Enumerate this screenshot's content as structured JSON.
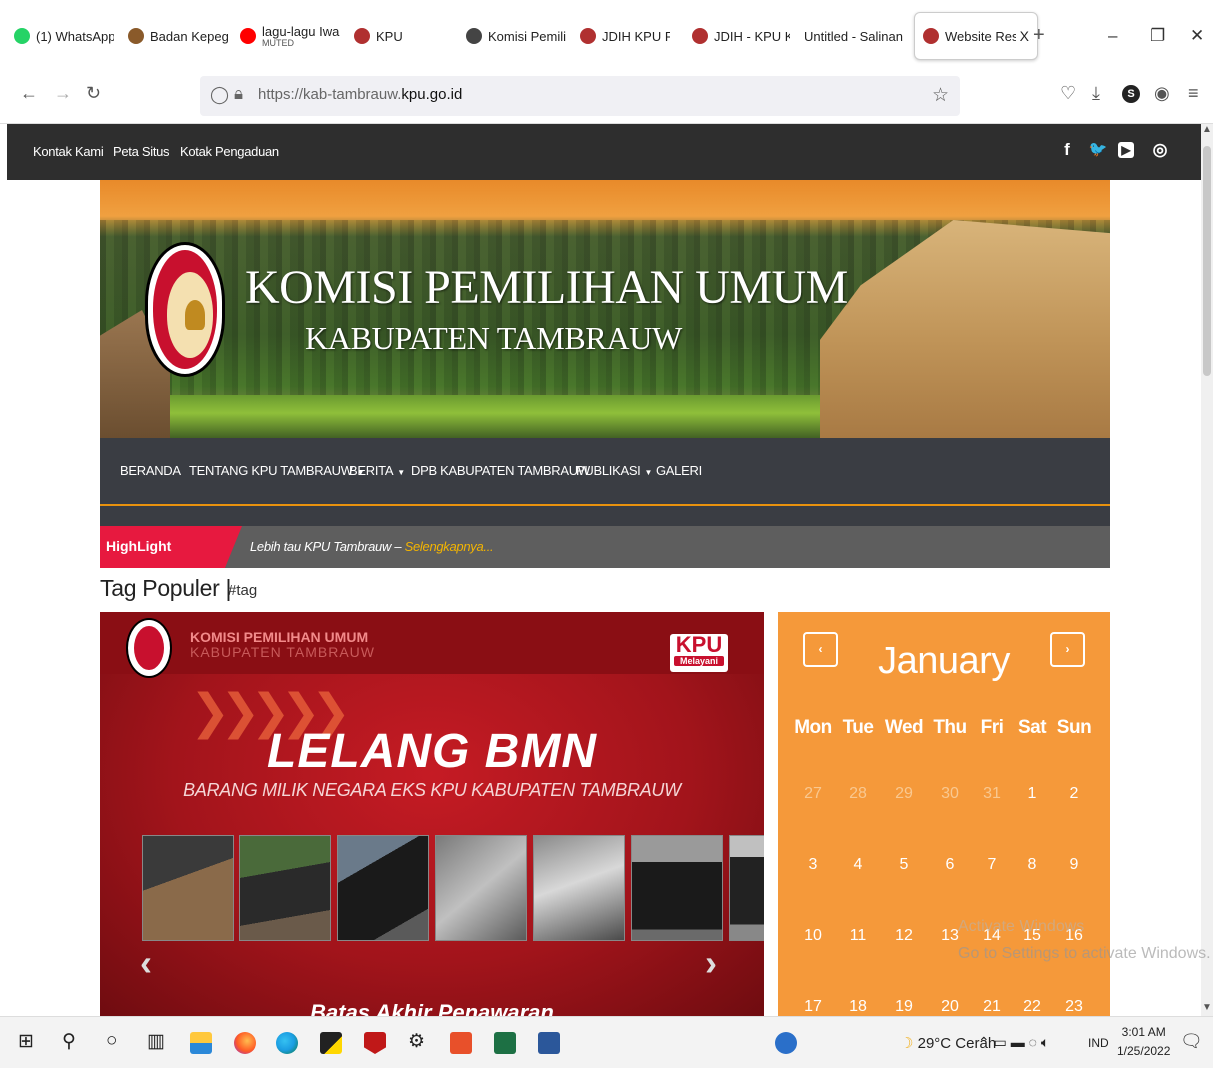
{
  "browser": {
    "tabs": [
      {
        "title": "(1) WhatsApp",
        "icon": "whatsapp-icon",
        "color": "#25d366"
      },
      {
        "title": "Badan Kepegaw",
        "icon": "kpu-logo-icon",
        "color": "#8a5a2a"
      },
      {
        "title": "lagu-lagu Iwan F",
        "subtitle": "MUTED",
        "icon": "youtube-icon",
        "color": "#ff0000"
      },
      {
        "title": "KPU",
        "icon": "kpu-logo-icon",
        "color": "#b03030"
      },
      {
        "title": "Komisi Pemiliha",
        "icon": "pkp-icon",
        "color": "#444444"
      },
      {
        "title": "JDIH KPU RI",
        "icon": "kpu-logo-icon",
        "color": "#b03030"
      },
      {
        "title": "JDIH - KPU KOTA",
        "icon": "kpu-logo-icon",
        "color": "#b03030"
      },
      {
        "title": "Untitled - Salinan Si",
        "icon": "",
        "color": ""
      },
      {
        "title": "Website Resmi",
        "icon": "kpu-logo-icon",
        "color": "#b03030",
        "active": true
      }
    ],
    "new_tab": "+",
    "close_tab": "X",
    "url_host_prefix": "https://kab-tambrauw.",
    "url_host_main": "kpu.go.id"
  },
  "site": {
    "top_links": [
      "Kontak Kami",
      "Peta Situs",
      "Kotak Pengaduan"
    ],
    "social": [
      {
        "icon": "facebook-icon",
        "glyph": "f"
      },
      {
        "icon": "twitter-icon",
        "glyph": "🐦"
      },
      {
        "icon": "youtube-icon",
        "glyph": "▶"
      },
      {
        "icon": "instagram-icon",
        "glyph": "◎"
      }
    ],
    "banner": {
      "title": "KOMISI PEMILIHAN UMUM",
      "subtitle": "KABUPATEN TAMBRAUW"
    },
    "menu": [
      {
        "label": "BERANDA",
        "dropdown": false
      },
      {
        "label": "TENTANG KPU TAMBRAUW",
        "dropdown": true
      },
      {
        "label": "BERITA",
        "dropdown": true
      },
      {
        "label": "DPB KABUPATEN TAMBRAUW",
        "dropdown": false
      },
      {
        "label": "PUBLIKASI",
        "dropdown": true
      },
      {
        "label": "GALERI",
        "dropdown": false
      }
    ],
    "highlight": {
      "label": "HighLight",
      "text": "Lebih tau KPU Tambrauw – ",
      "link": "Selengkapnya..."
    },
    "tag_title": "Tag Populer |",
    "tag_hash": "#tag",
    "slider": {
      "org": "KOMISI PEMILIHAN UMUM",
      "org_sub": "KABUPATEN TAMBRAUW",
      "badge_big": "KPU",
      "badge_small": "Melayani",
      "title": "LELANG BMN",
      "subtitle": "BARANG MILIK NEGARA EKS KPU KABUPATEN TAMBRAUW",
      "bottom_text": "Batas Akhir Penawaran",
      "prev": "‹",
      "next": "›"
    },
    "calendar": {
      "month": "January",
      "prev": "‹",
      "next": "›",
      "weekdays": [
        "Mon",
        "Tue",
        "Wed",
        "Thu",
        "Fri",
        "Sat",
        "Sun"
      ],
      "weeks": [
        [
          "27",
          "28",
          "29",
          "30",
          "31",
          "1",
          "2"
        ],
        [
          "3",
          "4",
          "5",
          "6",
          "7",
          "8",
          "9"
        ],
        [
          "10",
          "11",
          "12",
          "13",
          "14",
          "15",
          "16"
        ],
        [
          "17",
          "18",
          "19",
          "20",
          "21",
          "22",
          "23"
        ]
      ],
      "other_month_days": 5
    }
  },
  "watermark": {
    "line1": "Activate Windows",
    "line2": "Go to Settings to activate Windows."
  },
  "taskbar": {
    "weather": "29°C  Cerah",
    "lang": "IND",
    "time": "3:01 AM",
    "date": "1/25/2022"
  }
}
